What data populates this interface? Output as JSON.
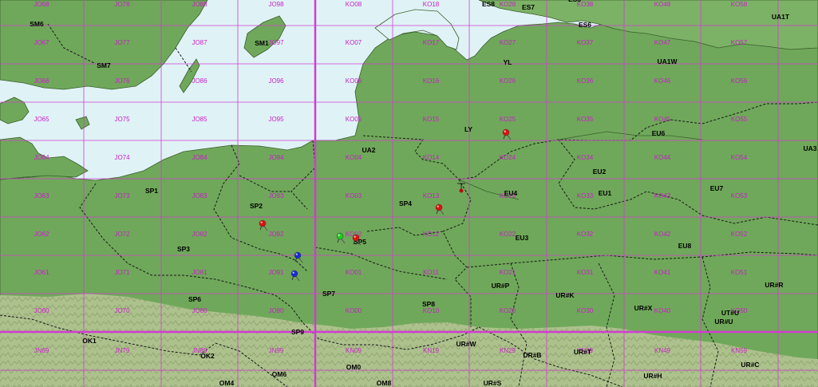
{
  "map": {
    "colors": {
      "sea": "#dff3f6",
      "land": "#6fa85a",
      "land_light": "#8dbd73",
      "mountain": "#b9c79a",
      "grid_line": "#d23cd2",
      "grid_label": "#c81ec8",
      "border": "#1a1a1a"
    },
    "grid_labels": [
      [
        "JO68",
        "JO78",
        "JO88",
        "JO98",
        "KO08",
        "KO18",
        "KO28",
        "KO38",
        "KO48",
        "KO58"
      ],
      [
        "JO67",
        "JO77",
        "JO87",
        "JO97",
        "KO07",
        "KO17",
        "KO27",
        "KO37",
        "KO47",
        "KO57"
      ],
      [
        "JO66",
        "JO76",
        "JO86",
        "JO96",
        "KO06",
        "KO16",
        "KO26",
        "KO36",
        "KO46",
        "KO56"
      ],
      [
        "JO65",
        "JO75",
        "JO85",
        "JO95",
        "KO05",
        "KO15",
        "KO25",
        "KO35",
        "KO45",
        "KO55"
      ],
      [
        "JO64",
        "JO74",
        "JO84",
        "JO94",
        "KO04",
        "KO14",
        "KO24",
        "KO34",
        "KO44",
        "KO54"
      ],
      [
        "JO63",
        "JO73",
        "JO83",
        "JO93",
        "KO03",
        "KO13",
        "KO23",
        "KO33",
        "KO43",
        "KO53"
      ],
      [
        "JO62",
        "JO72",
        "JO82",
        "JO92",
        "KO02",
        "KO12",
        "KO22",
        "KO32",
        "KO42",
        "KO52"
      ],
      [
        "JO61",
        "JO71",
        "JO81",
        "JO91",
        "KO01",
        "KO11",
        "KO21",
        "KO31",
        "KO41",
        "KO51"
      ],
      [
        "JO60",
        "JO70",
        "JO80",
        "JO90",
        "KO00",
        "KO10",
        "KO20",
        "KO30",
        "KO40",
        "KO50"
      ],
      [
        "JN69",
        "JN79",
        "JN89",
        "JN99",
        "KN09",
        "KN19",
        "KN29",
        "KN39",
        "KN49",
        "KN59"
      ]
    ],
    "callsign_labels": [
      "SM6",
      "SM7",
      "SM1",
      "ES8",
      "ES7",
      "ES3",
      "ES6",
      "UA1T",
      "UA1W",
      "YL",
      "LY",
      "UA2",
      "EU6",
      "UA3",
      "EU2",
      "EU4",
      "EU1",
      "EU7",
      "SP1",
      "SP2",
      "SP4",
      "SP3",
      "SP5",
      "EU3",
      "EU8",
      "SP6",
      "SP7",
      "SP8",
      "UR#P",
      "UR#K",
      "UR#R",
      "UR#X",
      "UT#U",
      "UR#U",
      "SP9",
      "OK1",
      "OK2",
      "UR#W",
      "UR#B",
      "UR#T",
      "UR#C",
      "OM6",
      "OM0",
      "UR#H",
      "OM4",
      "OM8",
      "UR#S"
    ],
    "markers": [
      {
        "name": "red-pin",
        "color": "#e01010"
      },
      {
        "name": "red-pin",
        "color": "#e01010"
      },
      {
        "name": "red-pin",
        "color": "#e01010"
      },
      {
        "name": "red-pin",
        "color": "#e01010"
      },
      {
        "name": "green-pin",
        "color": "#22cc22"
      },
      {
        "name": "blue-pin",
        "color": "#1a2bd6"
      },
      {
        "name": "blue-pin",
        "color": "#1a2bd6"
      },
      {
        "name": "station-icon",
        "color": "#b01010"
      }
    ]
  }
}
